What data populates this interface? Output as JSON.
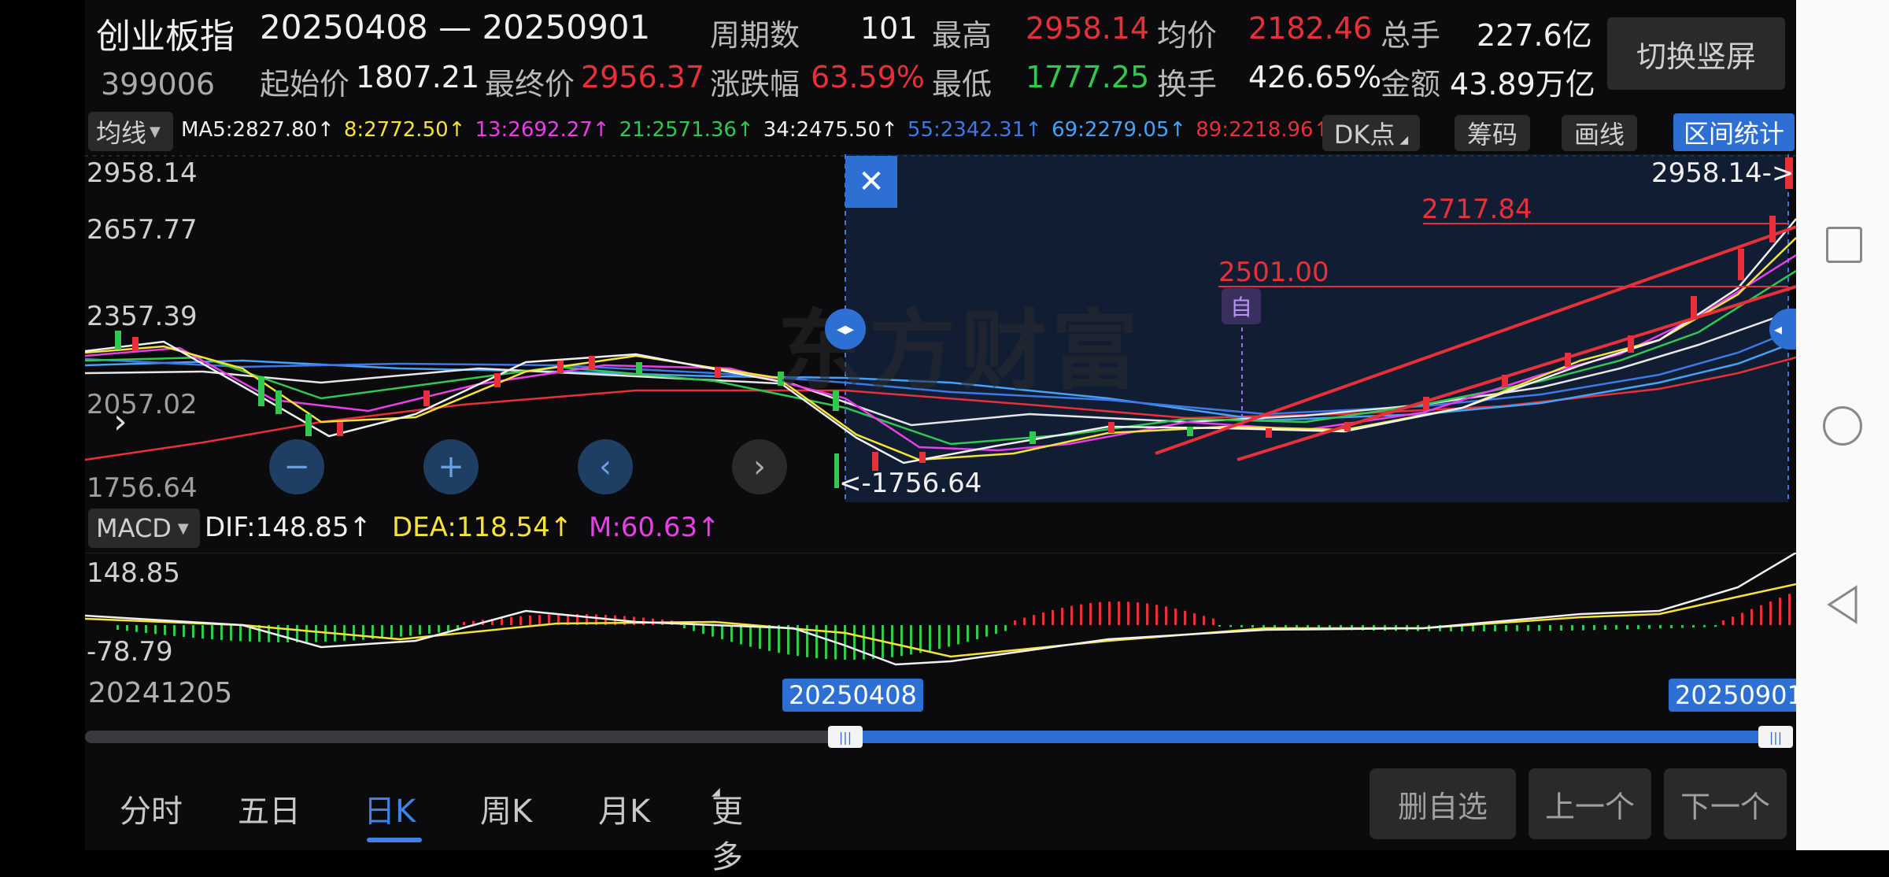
{
  "header": {
    "name": "创业板指",
    "range": "20250408 — 20250901",
    "code": "399006",
    "labels": {
      "periods": "周期数",
      "high": "最高",
      "avg": "均价",
      "vol": "总手",
      "open": "起始价",
      "close": "最终价",
      "change": "涨跌幅",
      "low": "最低",
      "turnover": "换手",
      "amount": "金额"
    },
    "values": {
      "periods": "101",
      "high": "2958.14",
      "avg": "2182.46",
      "vol": "227.6亿",
      "open": "1807.21",
      "close": "2956.37",
      "change": "63.59%",
      "low": "1777.25",
      "turnover": "426.65%",
      "amount": "43.89万亿"
    },
    "switch_label": "切换竖屏"
  },
  "ma_bar": {
    "selector": "均线",
    "items": [
      {
        "text": "MA5:2827.80↑",
        "color": "#f0f0f0"
      },
      {
        "text": "8:2772.50↑",
        "color": "#f5e33a"
      },
      {
        "text": "13:2692.27↑",
        "color": "#ea3ee8"
      },
      {
        "text": "21:2571.36↑",
        "color": "#32c84f"
      },
      {
        "text": "34:2475.50↑",
        "color": "#f0f0f0"
      },
      {
        "text": "55:2342.31↑",
        "color": "#3d78e6"
      },
      {
        "text": "69:2279.05↑",
        "color": "#46a2f5"
      },
      {
        "text": "89:2218.96↑",
        "color": "#e8303a"
      }
    ],
    "dk_label": "DK点",
    "chip_label": "筹码",
    "draw_label": "画线",
    "stats_label": "区间统计"
  },
  "price_axis": [
    "2958.14",
    "2657.77",
    "2357.39",
    "2057.02",
    "1756.64"
  ],
  "annotations": {
    "high_marker": "2958.14->",
    "line1": "2717.84",
    "line2": "2501.00",
    "self_mark": "自",
    "low_marker": "<-1756.64",
    "watermark": "东方财富"
  },
  "macd": {
    "selector": "MACD",
    "dif": "DIF:148.85↑",
    "dea": "DEA:118.54↑",
    "m": "M:60.63↑",
    "axis_top": "148.85",
    "axis_bottom": "-78.79"
  },
  "timeline": {
    "start_date": "20241205",
    "sel_start": "20250408",
    "sel_end": "20250901",
    "hidden_prefix": "2"
  },
  "tabs": [
    "分时",
    "五日",
    "日K",
    "周K",
    "月K",
    "更多"
  ],
  "active_tab": "日K",
  "bottom_buttons": {
    "remove": "删自选",
    "prev": "上一个",
    "next": "下一个"
  },
  "colors": {
    "up": "#e8303a",
    "down": "#32c84f",
    "accent": "#2e6fd4",
    "bg": "#0b0b0d"
  }
}
